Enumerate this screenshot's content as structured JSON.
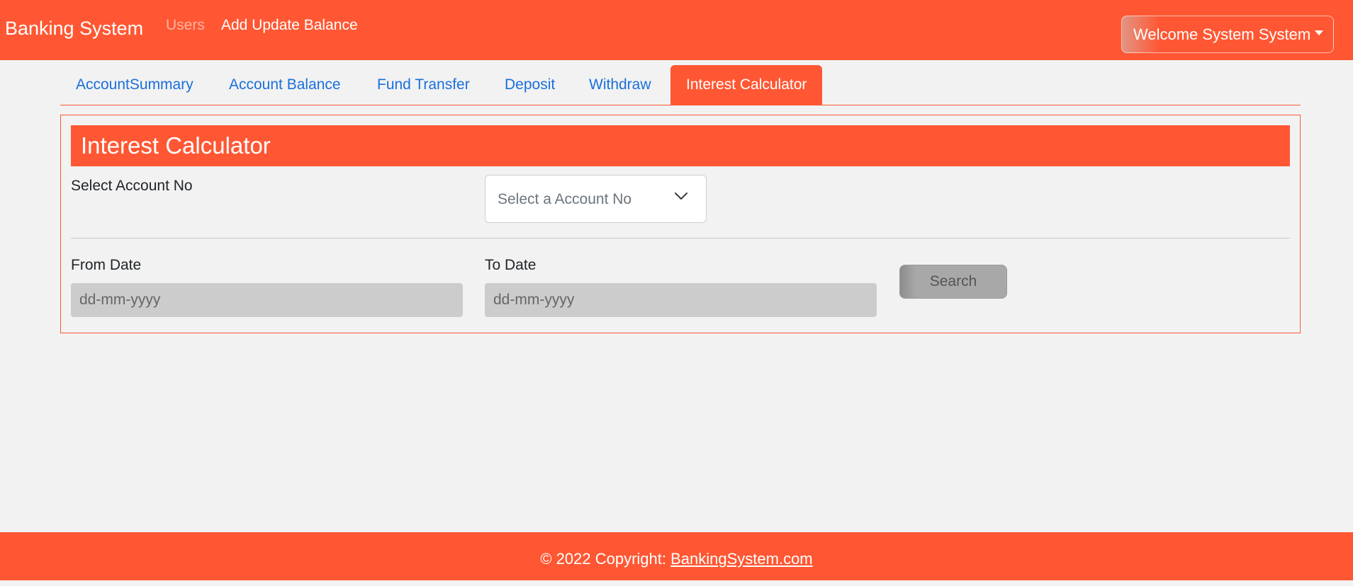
{
  "navbar": {
    "brand": "Banking System",
    "links": [
      {
        "label": "Users"
      },
      {
        "label": "Add Update Balance"
      }
    ],
    "welcome_label": "Welcome System System"
  },
  "tabs": [
    {
      "label": "AccountSummary"
    },
    {
      "label": "Account Balance"
    },
    {
      "label": "Fund Transfer"
    },
    {
      "label": "Deposit"
    },
    {
      "label": "Withdraw"
    },
    {
      "label": "Interest Calculator",
      "active": true
    }
  ],
  "card": {
    "title": "Interest Calculator",
    "account_label": "Select Account No",
    "account_select": {
      "placeholder": "Select a Account No"
    },
    "from_label": "From Date",
    "from_input": {
      "placeholder": "dd-mm-yyyy",
      "value": ""
    },
    "to_label": "To Date",
    "to_input": {
      "placeholder": "dd-mm-yyyy",
      "value": ""
    },
    "search_label": "Search"
  },
  "footer": {
    "prefix": "© 2022 Copyright: ",
    "link_text": "BankingSystem.com"
  },
  "colors": {
    "primary": "#ff5733",
    "background": "#f2f2f2",
    "tab_link": "#1a6fdc",
    "input_disabled": "#cccccc",
    "button_disabled": "#a8a8a8"
  },
  "icons": {
    "dropdown_caret": "caret-down-icon",
    "select_chevron": "chevron-down-icon"
  }
}
